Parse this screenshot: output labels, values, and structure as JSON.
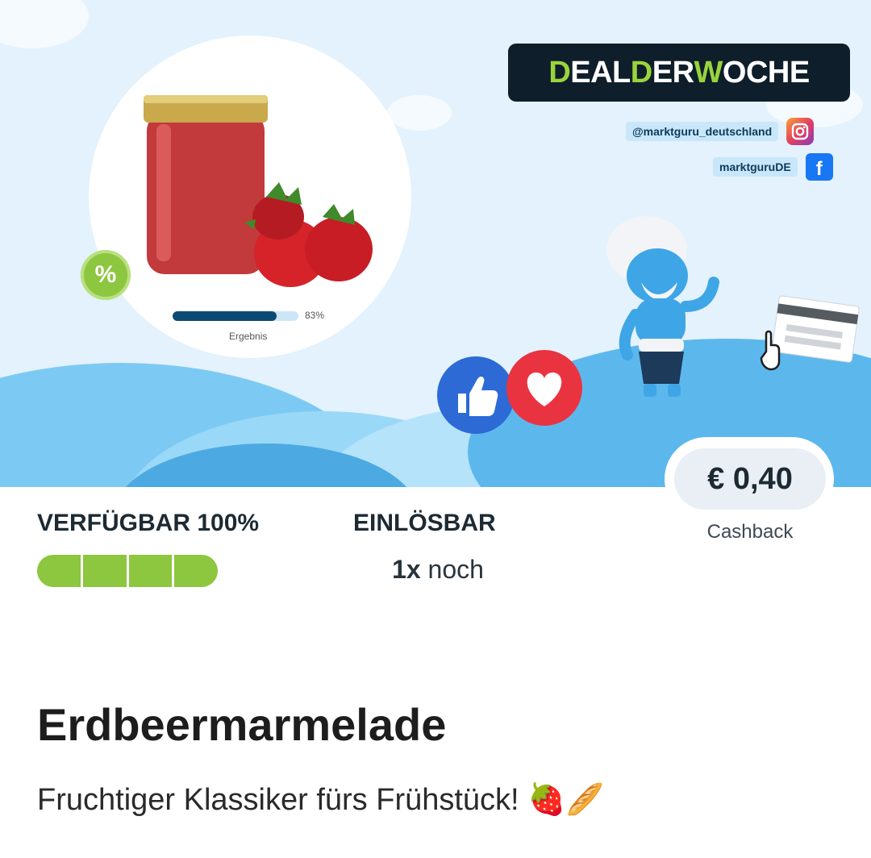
{
  "banner": {
    "deal_title_parts": [
      "D",
      "EAL ",
      "D",
      "ER ",
      "W",
      "OCHE"
    ],
    "instagram_handle": "@marktguru_deutschland",
    "facebook_handle": "marktguruDE",
    "product_progress_percent": 83,
    "product_progress_label": "83%",
    "product_progress_caption": "Ergebnis",
    "discount_badge": "%",
    "facebook_glyph": "f",
    "icons": [
      "percent-badge-icon",
      "instagram-icon",
      "facebook-icon",
      "like-icon",
      "heart-icon",
      "hand-pointer-icon",
      "receipt-card-icon"
    ],
    "colors": {
      "accent_green": "#8dc63f",
      "deal_bg": "#0f1e2b",
      "sky": "#e3f2fc",
      "hill": "#5cb8ec",
      "like_blue": "#2d6ad6",
      "heart_red": "#ea3340"
    }
  },
  "price": {
    "amount": "€ 0,40",
    "caption": "Cashback"
  },
  "availability": {
    "label": "VERFÜGBAR 100%",
    "percent": 100,
    "segments": 4
  },
  "redeemable": {
    "label": "EINLÖSBAR",
    "count": "1x",
    "suffix": " noch"
  },
  "product": {
    "title": "Erdbeermarmelade",
    "description": "Fruchtiger Klassiker fürs Frühstück! 🍓🥖"
  }
}
